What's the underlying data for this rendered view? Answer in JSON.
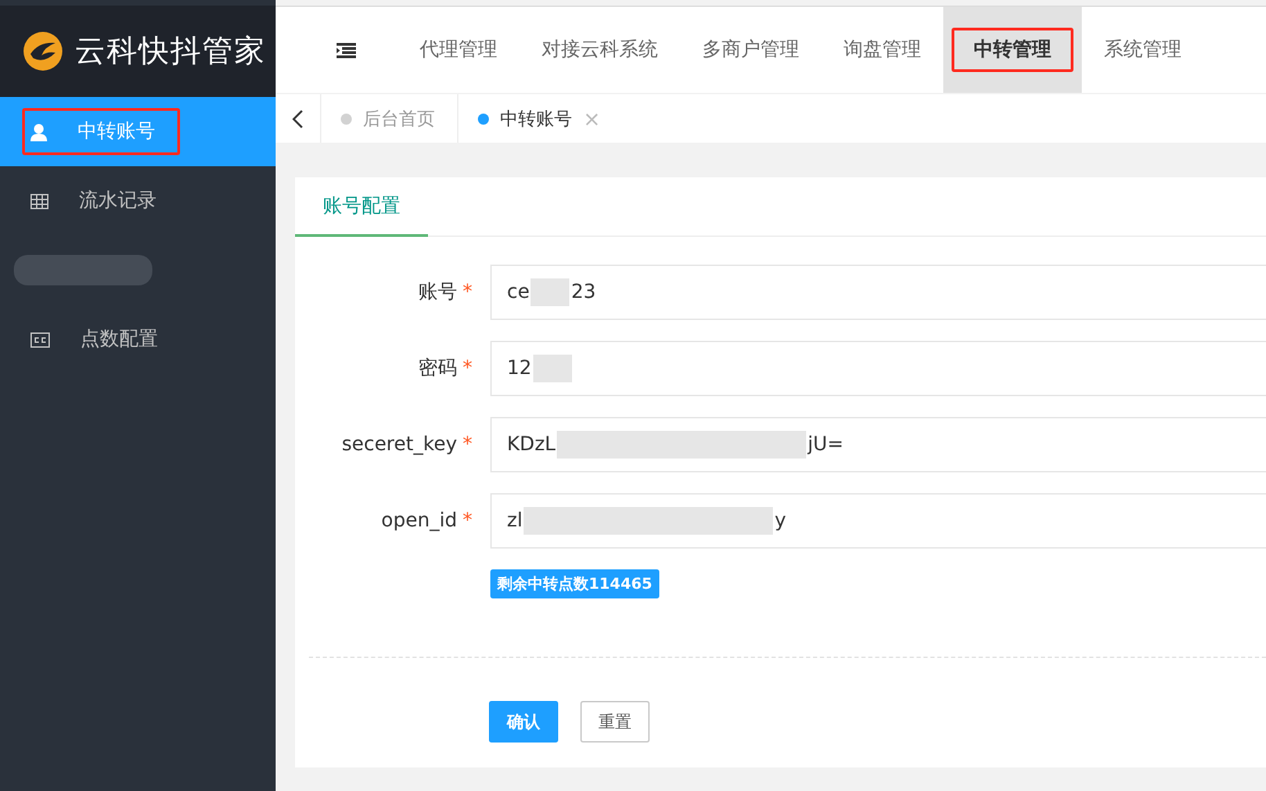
{
  "logo": {
    "title": "云科快抖管家"
  },
  "sidebar": {
    "items": [
      {
        "kind": "user",
        "label": "中转账号",
        "selected": true,
        "highlighted": true
      },
      {
        "kind": "table",
        "label": "流水记录",
        "selected": false,
        "highlighted": false
      },
      {
        "kind": "redacted"
      },
      {
        "kind": "cc",
        "label": "点数配置",
        "selected": false,
        "highlighted": false
      }
    ]
  },
  "top_nav": {
    "items": [
      {
        "label": "代理管理",
        "selected": false,
        "highlighted": false
      },
      {
        "label": "对接云科系统",
        "selected": false,
        "highlighted": false
      },
      {
        "label": "多商户管理",
        "selected": false,
        "highlighted": false
      },
      {
        "label": "询盘管理",
        "selected": false,
        "highlighted": false
      },
      {
        "label": "中转管理",
        "selected": true,
        "highlighted": true
      },
      {
        "label": "系统管理",
        "selected": false,
        "highlighted": false
      }
    ]
  },
  "page_tabs": [
    {
      "label": "后台首页",
      "selected": false
    },
    {
      "label": "中转账号",
      "selected": true,
      "close_label": "×"
    }
  ],
  "card": {
    "tab": "账号配置",
    "fields": [
      {
        "label": "账号",
        "required_mark": "*",
        "value_start": "ce",
        "value_end": "23"
      },
      {
        "label": "密码",
        "required_mark": "*",
        "value_start": "12"
      },
      {
        "label": "seceret_key",
        "required_mark": "*",
        "value_start": "KDzL",
        "value_end": "jU="
      },
      {
        "label": "open_id",
        "required_mark": "*",
        "value_start": "zl",
        "value_end": "y"
      }
    ],
    "badge": "剩余中转点数114465",
    "buttons": [
      {
        "kind": "primary",
        "label": "确认"
      },
      {
        "kind": "default",
        "label": "重置"
      }
    ]
  }
}
